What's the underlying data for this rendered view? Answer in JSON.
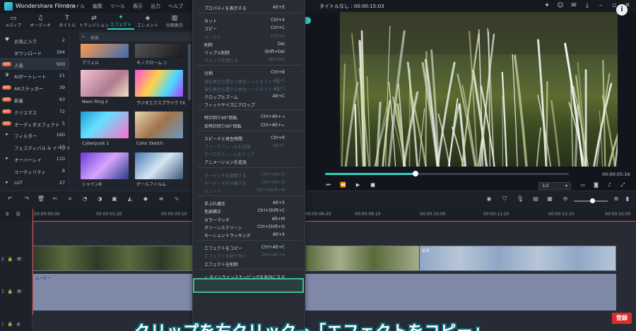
{
  "window": {
    "app_name": "Wondershare Filmora",
    "menu": [
      "ファイル",
      "編集",
      "ツール",
      "表示",
      "出力",
      "ヘルプ"
    ],
    "document_title": "タイトルなし : 00:00:15:03",
    "help_label": "i"
  },
  "media_tabs": [
    {
      "label": "メディア",
      "glyph": "▭"
    },
    {
      "label": "オーディオ",
      "glyph": "♫"
    },
    {
      "label": "タイトル",
      "glyph": "T"
    },
    {
      "label": "トランジション",
      "glyph": "⇄"
    },
    {
      "label": "エフェクト",
      "glyph": "✦",
      "active": true
    },
    {
      "label": "エレメント",
      "glyph": "◈"
    },
    {
      "label": "分割表示",
      "glyph": "▥"
    }
  ],
  "sidebar": [
    {
      "label": "お気に入り",
      "count": "2",
      "icon": "♥"
    },
    {
      "label": "ダウンロード",
      "count": "394",
      "icon": ""
    },
    {
      "label": "人気",
      "count": "500",
      "badge": "HOT",
      "active": true
    },
    {
      "label": "AIポートレート",
      "count": "21",
      "icon": "♛"
    },
    {
      "label": "ARステッカー",
      "count": "39",
      "badge": "HOT"
    },
    {
      "label": "新着",
      "count": "93",
      "badge": "HOT"
    },
    {
      "label": "クリスマス",
      "count": "72",
      "badge": "HOT"
    },
    {
      "label": "オーディオエフェクト",
      "count": "5",
      "badge": "HOT"
    },
    {
      "label": "フィルター",
      "count": "160",
      "icon": "▸"
    },
    {
      "label": "フェスティバル & イベント",
      "count": "10",
      "icon": ""
    },
    {
      "label": "オーバーレイ",
      "count": "110",
      "icon": "▸"
    },
    {
      "label": "ユーティリティ",
      "count": "8",
      "icon": ""
    },
    {
      "label": "LUT",
      "count": "27",
      "icon": "▸"
    }
  ],
  "effects": {
    "search_placeholder": "検索",
    "items": [
      {
        "label": "アフェル"
      },
      {
        "label": "モノクローム ニ"
      },
      {
        "label": "Neon Ring 2"
      },
      {
        "label": "ラジオエクスプライク FX"
      },
      {
        "label": "Cyberpunk 1"
      },
      {
        "label": "Color Sketch"
      },
      {
        "label": "シャイン8"
      },
      {
        "label": "グールフィルム"
      }
    ]
  },
  "context_menu": [
    {
      "label": "プロパティを表示する",
      "shortcut": "Alt+E",
      "enabled": true
    },
    {
      "sep": true
    },
    {
      "label": "カット",
      "shortcut": "Ctrl+X",
      "enabled": true
    },
    {
      "label": "コピー",
      "shortcut": "Ctrl+C",
      "enabled": true
    },
    {
      "label": "ペースト",
      "shortcut": "Ctrl+V",
      "enabled": false
    },
    {
      "label": "削除",
      "shortcut": "Del",
      "enabled": true
    },
    {
      "label": "リップル削除",
      "shortcut": "Shift+Del",
      "enabled": true
    },
    {
      "label": "ギャップを閉じる",
      "shortcut": "Alt+Del",
      "enabled": false
    },
    {
      "sep": true
    },
    {
      "label": "分割",
      "shortcut": "Ctrl+B",
      "enabled": true
    },
    {
      "label": "現在再生位置から再生ヘッドまでトリム",
      "shortcut": "Alt+[",
      "enabled": false
    },
    {
      "label": "現在再生位置から再生ヘッドまでトリム",
      "shortcut": "Alt+]",
      "enabled": false
    },
    {
      "label": "クロップとズーム",
      "shortcut": "Alt+C",
      "enabled": true
    },
    {
      "label": "フィットサイズにクロップ",
      "shortcut": "",
      "enabled": true
    },
    {
      "sep": true
    },
    {
      "label": "時計回り90°回転",
      "shortcut": "Ctrl+Alt+→",
      "enabled": true
    },
    {
      "label": "反時計回り90°回転",
      "shortcut": "Ctrl+Alt+←",
      "enabled": true
    },
    {
      "sep": true
    },
    {
      "label": "スピードと再生時間",
      "shortcut": "Ctrl+R",
      "enabled": true
    },
    {
      "label": "フリーズフレームを追加",
      "shortcut": "Alt+F",
      "enabled": false
    },
    {
      "label": "すべてのフレームをクリア",
      "shortcut": "",
      "enabled": false
    },
    {
      "label": "アニメーションを追加",
      "shortcut": "",
      "enabled": true
    },
    {
      "sep": true
    },
    {
      "label": "オーディオを調整する",
      "shortcut": "Ctrl+Alt+D",
      "enabled": false
    },
    {
      "label": "オーディオを分離する",
      "shortcut": "Ctrl+Alt+D",
      "enabled": false
    },
    {
      "label": "ミュート",
      "shortcut": "Ctrl+Shift+M",
      "enabled": false
    },
    {
      "sep": true
    },
    {
      "label": "手ぶれ補正",
      "shortcut": "Alt+S",
      "enabled": true
    },
    {
      "label": "色調補正",
      "shortcut": "Ctrl+Shift+C",
      "enabled": true
    },
    {
      "label": "カラーマッチ",
      "shortcut": "Alt+M",
      "enabled": true
    },
    {
      "label": "グリーンスクリーン",
      "shortcut": "Ctrl+Shift+G",
      "enabled": true
    },
    {
      "label": "モーショントラッキング",
      "shortcut": "Alt+X",
      "enabled": true
    },
    {
      "sep": true
    },
    {
      "label": "エフェクトをコピー",
      "shortcut": "Ctrl+Alt+C",
      "enabled": true,
      "highlight": true
    },
    {
      "label": "エフェクトを貼り付け",
      "shortcut": "Ctrl+Alt+V",
      "enabled": false
    },
    {
      "label": "エフェクトを削除",
      "shortcut": "",
      "enabled": true
    },
    {
      "sep": true
    },
    {
      "label": "✓ タイムラインスナッピングを有効にする",
      "shortcut": "",
      "enabled": true
    }
  ],
  "preview": {
    "progress": 0.37,
    "time": "00:00:05:16",
    "zoom": "1/2"
  },
  "timeline": {
    "ruler": [
      "00:00:00:00",
      "00:00:01:20",
      "00:00:03:10",
      "00:00:06:20",
      "00:00:08:10",
      "00:00:10:00",
      "00:00:11:20",
      "00:00:13:10",
      "00:00:15:00"
    ],
    "video_track_label": "2",
    "audio_track_label": "1",
    "video_clip_label": "動画",
    "audio_clip_label": "ムービー"
  },
  "caption": "クリップを右クリック→「エフェクトをコピー」",
  "stamp": "登録"
}
